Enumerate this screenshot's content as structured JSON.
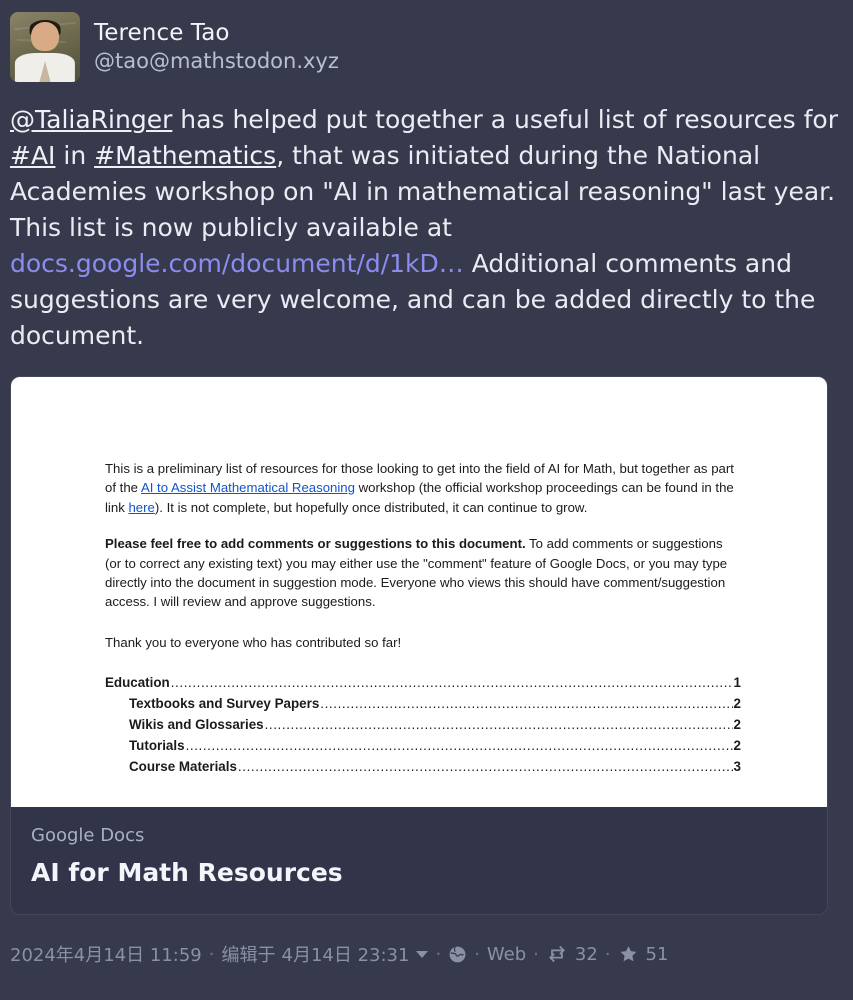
{
  "account": {
    "display_name": "Terence Tao",
    "handle": "@tao@mathstodon.xyz",
    "avatar_alt": "avatar"
  },
  "post": {
    "mention": "@TaliaRinger",
    "text_1": " has helped put together a useful list of resources for ",
    "hashtag_1": "#AI",
    "text_2": " in ",
    "hashtag_2": "#Mathematics",
    "text_3": ", that was initiated during the National Academies workshop on \"AI in mathematical reasoning\" last year. This list is now publicly available at ",
    "link_label": "docs.google.com/document/d/1kD",
    "link_ellipsis": "…",
    "text_4": "  Additional comments and suggestions are very welcome, and can be added directly to the document."
  },
  "card": {
    "provider": "Google Docs",
    "title": "AI for Math Resources",
    "preview": {
      "para_1_a": "This is a preliminary list of resources for those looking to get into the field of AI for Math, but together as part of the ",
      "para_1_link": "AI to Assist Mathematical Reasoning",
      "para_1_b": " workshop (the official workshop proceedings can be found in the link ",
      "para_1_link2": "here",
      "para_1_c": "). It is not complete, but hopefully once distributed, it can continue to grow.",
      "para_2_bold": "Please feel free to add comments or suggestions to this document.",
      "para_2_rest": " To add comments or suggestions (or to correct any existing text) you may either use the \"comment\" feature of Google Docs, or you may type directly into the document in suggestion mode. Everyone who views this should have comment/suggestion access. I will review and approve suggestions.",
      "para_3": "Thank you to everyone who has contributed so far!",
      "toc": [
        {
          "label": "Education",
          "page": "1",
          "level": 1
        },
        {
          "label": "Textbooks and Survey Papers",
          "page": "2",
          "level": 2
        },
        {
          "label": "Wikis and Glossaries",
          "page": "2",
          "level": 2
        },
        {
          "label": "Tutorials",
          "page": "2",
          "level": 2
        },
        {
          "label": "Course Materials",
          "page": "3",
          "level": 2
        }
      ]
    }
  },
  "meta": {
    "posted": "2024年4月14日 11:59",
    "edited_prefix": "编辑于",
    "edited_time": "4月14日 23:31",
    "visibility_icon": "globe-icon",
    "source": "Web",
    "boost_icon": "boost-icon",
    "boost_count": "32",
    "favourite_icon": "star-icon",
    "favourite_count": "51",
    "separator": "·"
  },
  "colors": {
    "background": "#373a4c",
    "card_background": "#32354a",
    "link": "#8c8cf0",
    "muted_text": "#8a90a6",
    "doc_link": "#1155cc"
  }
}
